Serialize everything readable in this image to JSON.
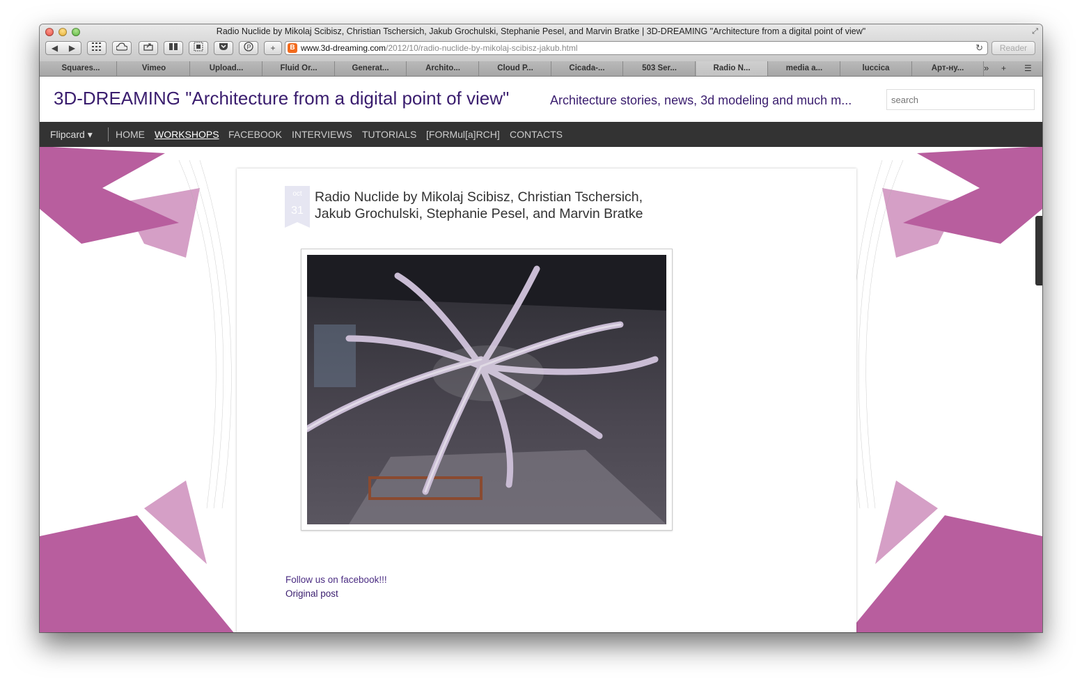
{
  "window": {
    "title": "Radio Nuclide by Mikolaj Scibisz, Christian Tschersich, Jakub Grochulski, Stephanie Pesel, and Marvin Bratke | 3D-DREAMING \"Architecture from a digital point of view\""
  },
  "toolbar": {
    "back_label": "◀",
    "forward_label": "▶",
    "url_domain": "www.3d-dreaming.com",
    "url_path": "/2012/10/radio-nuclide-by-mikolaj-scibisz-jakub.html",
    "reader_label": "Reader"
  },
  "bookmarks": [
    "Squares...",
    "Vimeo",
    "Upload...",
    "Fluid Or...",
    "Generat...",
    "Archito...",
    "Cloud P...",
    "Cicada-...",
    "503 Ser...",
    "Radio N...",
    "media a...",
    "luccica",
    "Арт-ну..."
  ],
  "site": {
    "title": "3D-DREAMING \"Architecture from a digital point of view\"",
    "subtitle": "Architecture stories, news, 3d modeling and much m...",
    "search_placeholder": "search"
  },
  "menu": {
    "flipcard": "Flipcard",
    "items": [
      "HOME",
      "WORKSHOPS",
      "FACEBOOK",
      "INTERVIEWS",
      "TUTORIALS",
      "[FORMul[a]RCH]",
      "CONTACTS"
    ],
    "active": "WORKSHOPS"
  },
  "post": {
    "date_month": "oct",
    "date_day": "31",
    "title": "Radio Nuclide by Mikolaj Scibisz, Christian Tschersich, Jakub Grochulski, Stephanie Pesel, and Marvin Bratke",
    "facebook_link": "Follow us on facebook!!!",
    "original_link": "Original post"
  },
  "colors": {
    "accent": "#3a1d6e",
    "menu_bg": "#333333",
    "deco": "#a0287e"
  }
}
